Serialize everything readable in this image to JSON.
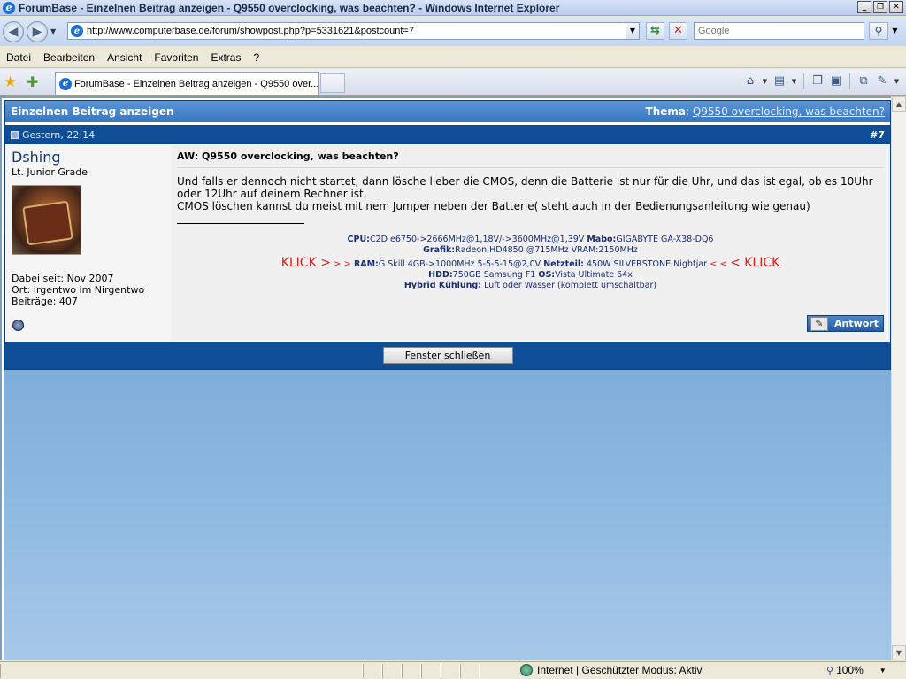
{
  "window": {
    "title": "ForumBase - Einzelnen Beitrag anzeigen - Q9550 overclocking, was beachten? - Windows Internet Explorer",
    "min_glyph": "_",
    "max_glyph": "❐",
    "close_glyph": "✕"
  },
  "address": {
    "url": "http://www.computerbase.de/forum/showpost.php?p=5331621&postcount=7",
    "search_placeholder": "Google"
  },
  "menu": [
    "Datei",
    "Bearbeiten",
    "Ansicht",
    "Favoriten",
    "Extras",
    "?"
  ],
  "tab": {
    "label": "ForumBase - Einzelnen Beitrag anzeigen - Q9550 over..."
  },
  "page": {
    "header_title": "Einzelnen Beitrag anzeigen",
    "thema_label": "Thema",
    "thema_link": "Q9550 overclocking, was beachten?",
    "date": "Gestern, 22:14",
    "post_number": "#7",
    "user": {
      "name": "Dshing",
      "rank": "Lt. Junior Grade",
      "joined": "Dabei seit: Nov 2007",
      "location": "Ort: Irgentwo im Nirgentwo",
      "posts": "Beiträge: 407"
    },
    "post": {
      "title": "AW: Q9550 overclocking, was beachten?",
      "line1": "Und falls er dennoch nicht startet, dann lösche lieber die CMOS, denn die Batterie ist nur für die Uhr, und das ist egal, ob es 10Uhr oder 12Uhr auf deinem Rechner ist.",
      "line2": "CMOS löschen kannst du meist mit nem Jumper neben der Batterie( steht auch in der Bedienungsanleitung wie genau)"
    },
    "signature": {
      "cpu_label": "CPU:",
      "cpu": "C2D e6750->2666MHz@1,18V/->3600MHz@1,39V",
      "mabo_label": "Mabo:",
      "mabo": "GIGABYTE GA-X38-DQ6",
      "grafik_label": "Grafik:",
      "grafik": "Radeon HD4850 @715MHz VRAM:2150MHz",
      "klick_left": "KLICK >",
      "arrows_left": "> >",
      "ram_label": "RAM:",
      "ram": "G.Skill 4GB->1000MHz 5-5-5-15@2,0V",
      "netzteil_label": "Netzteil:",
      "netzteil": "450W SILVERSTONE Nightjar",
      "arrows_right": "< <",
      "klick_right": "< KLICK",
      "hdd_label": "HDD:",
      "hdd": "750GB Samsung F1",
      "os_label": "OS:",
      "os": "Vista Ultimate 64x",
      "kuehlung_label": "Hybrid Kühlung:",
      "kuehlung": "Luft oder Wasser (komplett umschaltbar)"
    },
    "reply_button": "Antwort",
    "close_button": "Fenster schließen"
  },
  "status": {
    "zone": "Internet | Geschützter Modus: Aktiv",
    "zoom": "100%"
  },
  "colors": {
    "header_blue": "#3a76be",
    "dark_blue": "#0d4e97",
    "klick_red": "#e02020",
    "username_blue": "#15396c"
  }
}
